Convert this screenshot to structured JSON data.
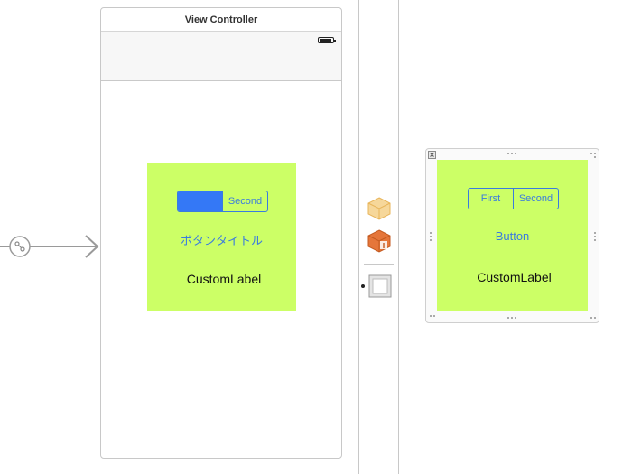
{
  "scene": {
    "title": "View Controller",
    "segmented": {
      "items": [
        "",
        "Second"
      ],
      "selected_index": 0
    },
    "button_label": "ボタンタイトル",
    "custom_label": "CustomLabel"
  },
  "xib": {
    "segmented": {
      "items": [
        "First",
        "Second"
      ],
      "selected_index": -1
    },
    "button_label": "Button",
    "custom_label": "CustomLabel"
  },
  "colors": {
    "view_background": "#ccff66",
    "tint": "#3478f6",
    "first_responder": "#f6d79a",
    "exit_icon": "#e5763a"
  },
  "icons": [
    "entry-point-arrow-icon",
    "first-responder-cube-icon",
    "exit-icon",
    "view-object-icon",
    "close-icon"
  ]
}
